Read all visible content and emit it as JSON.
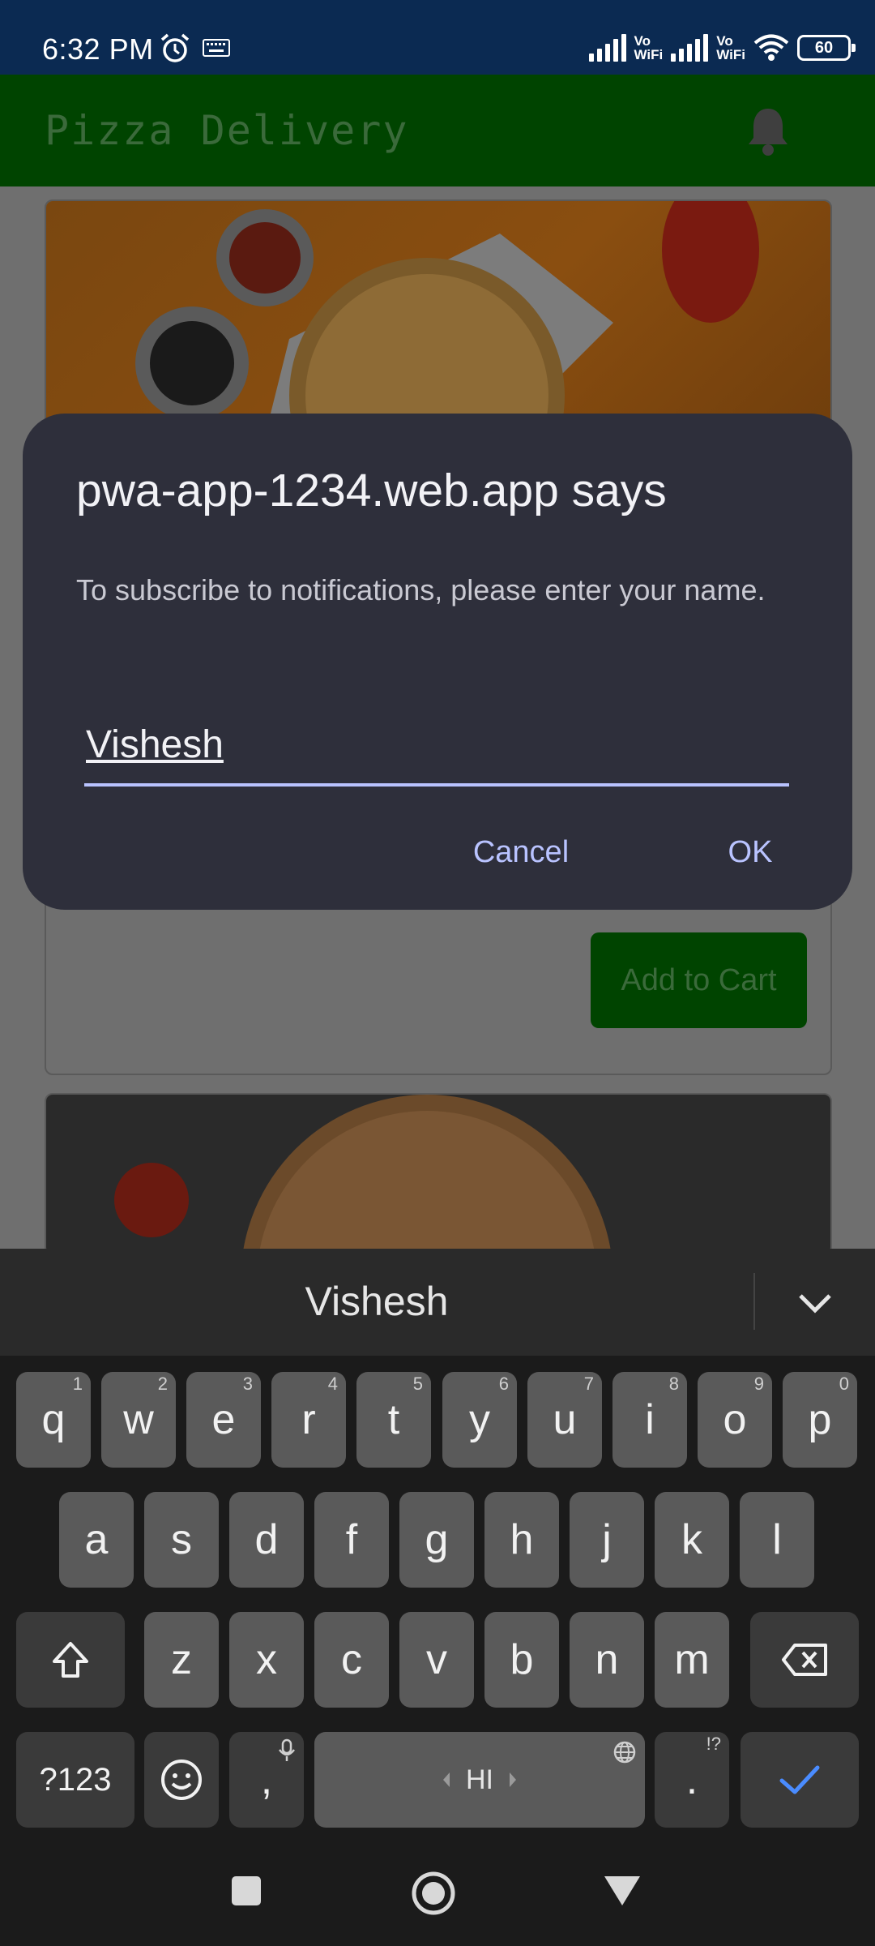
{
  "status_bar": {
    "time": "6:32 PM",
    "network_1": "Vo\nWiFi",
    "network_2": "Vo\nWiFi",
    "battery": "60",
    "icons": [
      "alarm-icon",
      "keyboard-icon",
      "signal-icon",
      "wifi-icon",
      "battery-icon"
    ]
  },
  "app": {
    "title": "Pizza Delivery",
    "bell_icon": "bell-icon",
    "card": {
      "add_to_cart_label": "Add to Cart"
    }
  },
  "dialog": {
    "title": "pwa-app-1234.web.app says",
    "message": "To subscribe to notifications, please enter your name.",
    "input_value": "Vishesh",
    "cancel_label": "Cancel",
    "ok_label": "OK",
    "accent_color": "#b9c3ff"
  },
  "keyboard": {
    "suggestion": "Vishesh",
    "row1": [
      {
        "key": "q",
        "hint": "1"
      },
      {
        "key": "w",
        "hint": "2"
      },
      {
        "key": "e",
        "hint": "3"
      },
      {
        "key": "r",
        "hint": "4"
      },
      {
        "key": "t",
        "hint": "5"
      },
      {
        "key": "y",
        "hint": "6"
      },
      {
        "key": "u",
        "hint": "7"
      },
      {
        "key": "i",
        "hint": "8"
      },
      {
        "key": "o",
        "hint": "9"
      },
      {
        "key": "p",
        "hint": "0"
      }
    ],
    "row2": [
      "a",
      "s",
      "d",
      "f",
      "g",
      "h",
      "j",
      "k",
      "l"
    ],
    "row3": [
      "z",
      "x",
      "c",
      "v",
      "b",
      "n",
      "m"
    ],
    "symbols_label": "?123",
    "comma": ",",
    "period": ".",
    "period_hint": "!?",
    "space_label": "HI",
    "enter_color": "#4a8cff"
  },
  "nav": {
    "icons": [
      "recents-square-icon",
      "home-circle-icon",
      "back-triangle-icon"
    ]
  }
}
